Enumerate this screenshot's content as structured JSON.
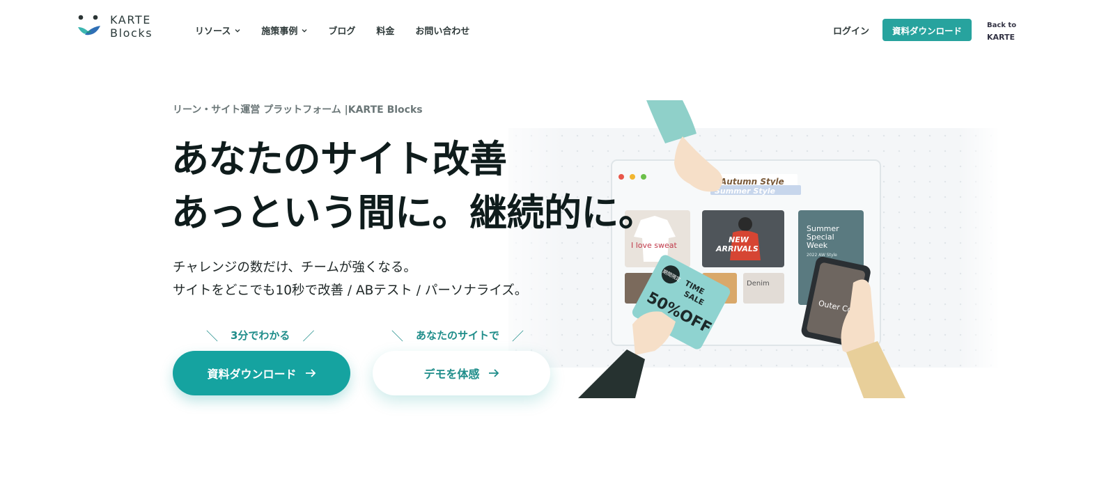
{
  "header": {
    "logo": {
      "line1": "KARTE",
      "line2": "Blocks"
    },
    "nav": [
      {
        "label": "リソース",
        "has_dropdown": true
      },
      {
        "label": "施策事例",
        "has_dropdown": true
      },
      {
        "label": "ブログ",
        "has_dropdown": false
      },
      {
        "label": "料金",
        "has_dropdown": false
      },
      {
        "label": "お問い合わせ",
        "has_dropdown": false
      }
    ],
    "login_label": "ログイン",
    "cta_label": "資料ダウンロード",
    "back_line1": "Back to",
    "back_line2": "KARTE"
  },
  "hero": {
    "eyebrow": "リーン・サイト運営 プラットフォーム |KARTE Blocks",
    "headline_line1": "あなたのサイト改善",
    "headline_line2": "あっという間に。継続的に。",
    "sub_line1": "チャレンジの数だけ、チームが強くなる。",
    "sub_line2": "サイトをどこでも10秒で改善 / ABテスト / パーソナライズ。",
    "lead1": "3分でわかる",
    "lead2": "あなたのサイトで",
    "primary_button": "資料ダウンロード",
    "secondary_button": "デモを体感"
  },
  "illustration": {
    "tab_text1": "Autumn Style",
    "tab_text2": "Summer Style",
    "card1": "I love sweat",
    "card2_line1": "NEW",
    "card2_line2": "ARRIVALS",
    "card3_line1": "Summer",
    "card3_line2": "Special",
    "card3_line3": "Week",
    "card3_small": "2022 AW Style",
    "card4": "Denim",
    "card5": "Outer Colle",
    "sale_badge": "期間限定",
    "sale_line1": "TIME",
    "sale_line2": "SALE",
    "sale_pct": "50%OFF"
  },
  "colors": {
    "accent": "#15a3a0",
    "accent_dark": "#1f8d8a",
    "text": "#0f1c1c",
    "logo_teal": "#3cb6b0",
    "logo_blue": "#2f6fb5"
  }
}
